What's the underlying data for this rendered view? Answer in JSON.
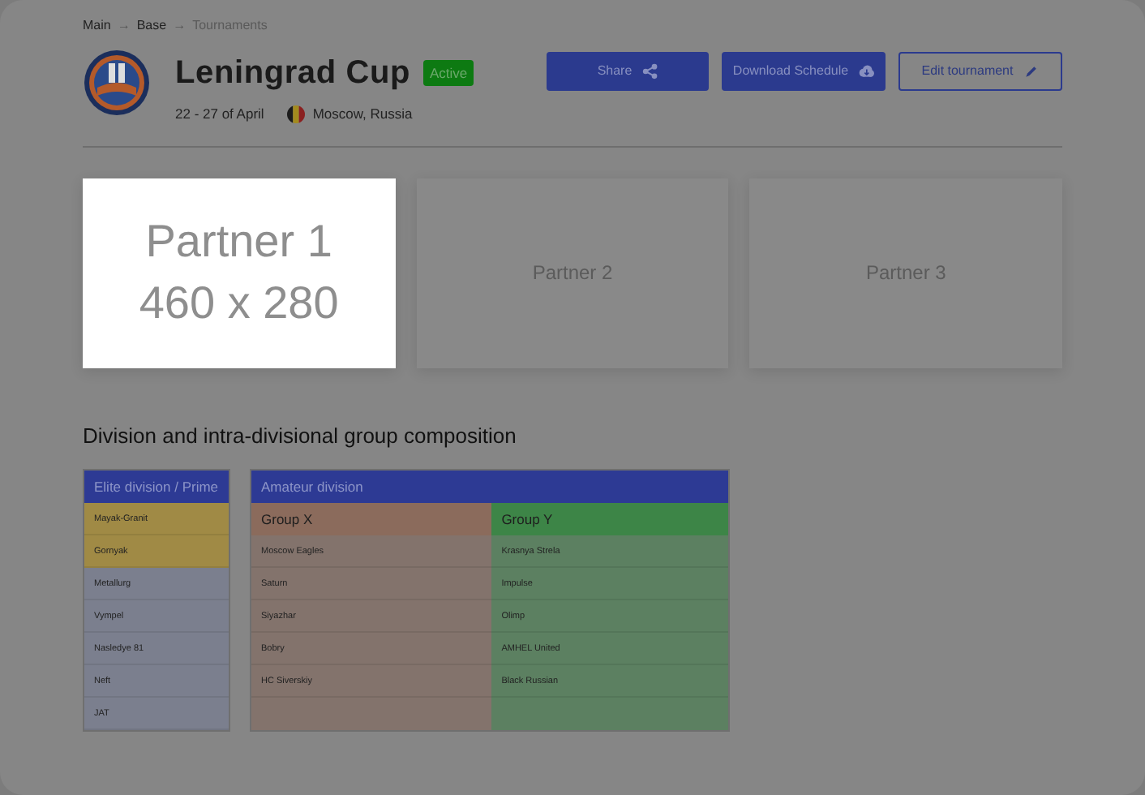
{
  "breadcrumb": [
    {
      "label": "Main",
      "current": false
    },
    {
      "label": "→",
      "kind": "separator"
    },
    {
      "label": "Base",
      "current": false
    },
    {
      "label": "→",
      "kind": "separator"
    },
    {
      "label": "Tournaments",
      "current": true
    }
  ],
  "tournament": {
    "title": "Leningrad Cup",
    "status": "Active",
    "dates": "22 - 27 of April",
    "location": "Moscow, Russia"
  },
  "actions": [
    {
      "label": "Share",
      "kind": "share",
      "outline": false
    },
    {
      "label": "Download Schedule",
      "kind": "download",
      "outline": false
    },
    {
      "label": "Edit tournament",
      "kind": "edit",
      "outline": true
    }
  ],
  "partners": [
    {
      "label": "Partner 1",
      "size": "460 x 280",
      "highlighted": true
    },
    {
      "label": "Partner 2",
      "highlighted": false
    },
    {
      "label": "Partner 3",
      "highlighted": false
    }
  ],
  "section_title": "Division and intra-divisional group composition",
  "divisions": [
    {
      "title": "Elite division / Prime",
      "groups": [
        {
          "teams": [
            {
              "name": "Mayak-Granit",
              "color": "#a08a45"
            },
            {
              "name": "Gornyak",
              "color": "#a08a45"
            },
            {
              "name": "Metallurg",
              "color": "#7b7f8e"
            },
            {
              "name": "Vympel",
              "color": "#7b7f8e"
            },
            {
              "name": "Nasledye 81",
              "color": "#7b7f8e"
            },
            {
              "name": "Neft",
              "color": "#7b7f8e"
            },
            {
              "name": "JAT",
              "color": "#7b7f8e"
            }
          ]
        }
      ]
    },
    {
      "title": "Amateur division",
      "groups": [
        {
          "title": "Group X",
          "color": "#8b6b5c",
          "teams": [
            {
              "name": "Moscow Eagles"
            },
            {
              "name": "Saturn"
            },
            {
              "name": "Siyazhar"
            },
            {
              "name": "Bobry"
            },
            {
              "name": "HC Siverskiy"
            }
          ]
        },
        {
          "title": "Group Y",
          "color": "#3d8547",
          "teams": [
            {
              "name": "Krasnya Strela"
            },
            {
              "name": "Impulse"
            },
            {
              "name": "Olimp"
            },
            {
              "name": "AMHEL United"
            },
            {
              "name": "Black Russian"
            }
          ]
        }
      ]
    }
  ]
}
